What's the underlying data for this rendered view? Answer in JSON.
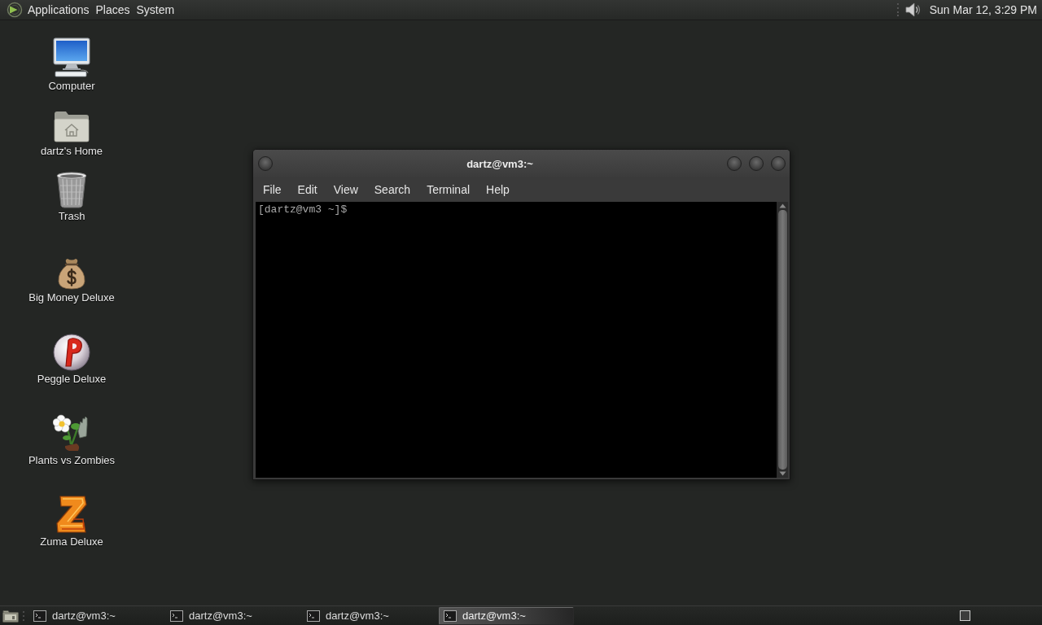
{
  "top_panel": {
    "menus": [
      {
        "label": "Applications"
      },
      {
        "label": "Places"
      },
      {
        "label": "System"
      }
    ],
    "clock": "Sun Mar 12, 3:29 PM"
  },
  "desktop_icons": [
    {
      "label": "Computer",
      "kind": "computer"
    },
    {
      "label": "dartz's Home",
      "kind": "home"
    },
    {
      "label": "Trash",
      "kind": "trash"
    },
    {
      "label": "Big Money Deluxe",
      "kind": "moneybag"
    },
    {
      "label": "Peggle Deluxe",
      "kind": "peggle"
    },
    {
      "label": "Plants vs Zombies",
      "kind": "plants"
    },
    {
      "label": "Zuma Deluxe",
      "kind": "zuma"
    }
  ],
  "terminal_window": {
    "title": "dartz@vm3:~",
    "menu": [
      "File",
      "Edit",
      "View",
      "Search",
      "Terminal",
      "Help"
    ],
    "lines": [
      "[dartz@vm3 ~]$"
    ]
  },
  "taskbar": {
    "tasks": [
      {
        "label": "dartz@vm3:~",
        "selected": false
      },
      {
        "label": "dartz@vm3:~",
        "selected": false
      },
      {
        "label": "dartz@vm3:~",
        "selected": false
      },
      {
        "label": "dartz@vm3:~",
        "selected": true
      }
    ]
  }
}
